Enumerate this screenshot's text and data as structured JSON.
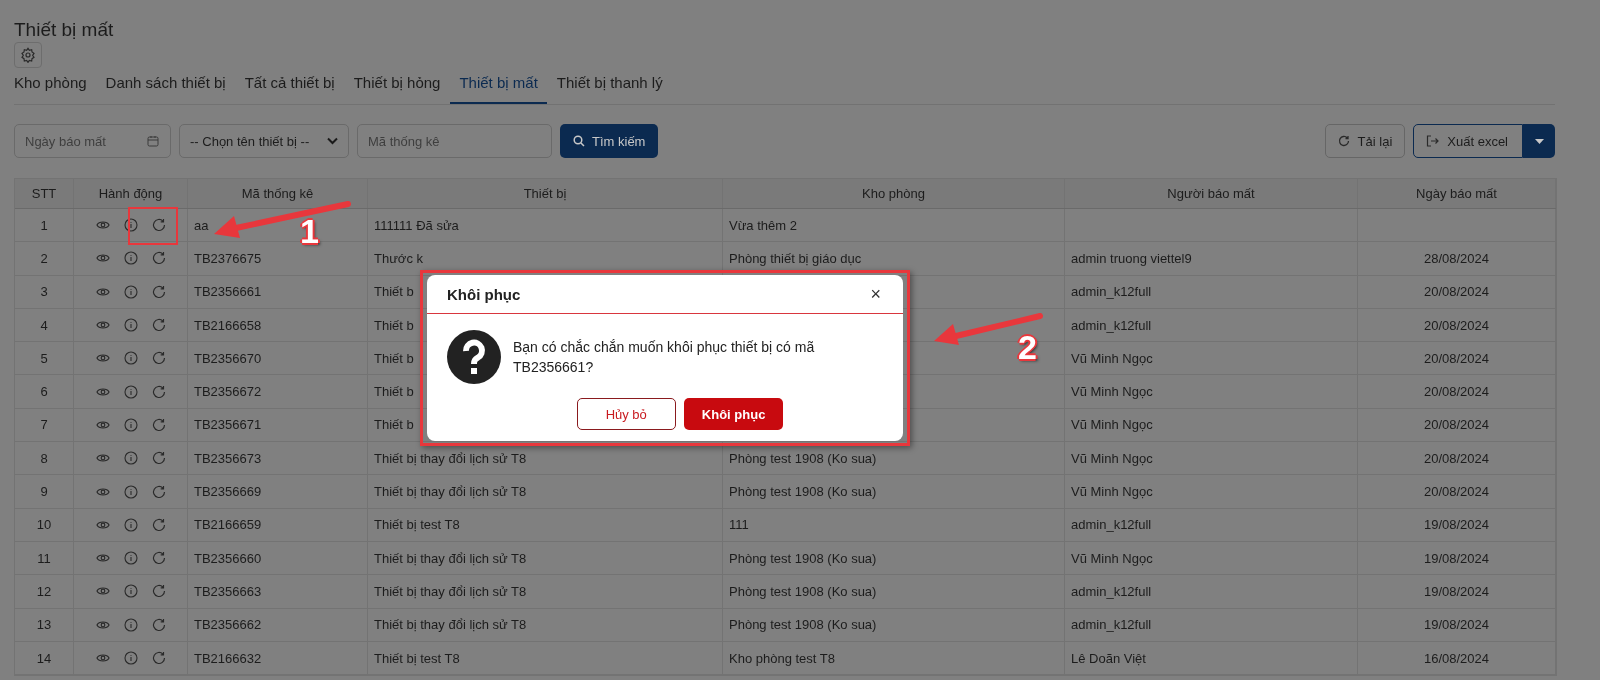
{
  "page": {
    "title": "Thiết bị mất"
  },
  "tabs": [
    {
      "label": "Kho phòng",
      "selected": false
    },
    {
      "label": "Danh sách thiết bị",
      "selected": false
    },
    {
      "label": "Tất cả thiết bị",
      "selected": false
    },
    {
      "label": "Thiết bị hỏng",
      "selected": false
    },
    {
      "label": "Thiết bị mất",
      "selected": true
    },
    {
      "label": "Thiết bị thanh lý",
      "selected": false
    }
  ],
  "filters": {
    "date": {
      "placeholder": "Ngày báo mất"
    },
    "device_select": {
      "value": "-- Chọn tên thiết bị --"
    },
    "code": {
      "placeholder": "Mã thống kê"
    },
    "search_button": "Tìm kiếm"
  },
  "toolbar": {
    "reload_button": "Tải lại",
    "export_button": "Xuất excel"
  },
  "table": {
    "columns": [
      "STT",
      "Hành động",
      "Mã thống kê",
      "Thiết bị",
      "Kho phòng",
      "Người báo mất",
      "Ngày báo mất"
    ],
    "rows": [
      {
        "stt": "1",
        "code": "aa",
        "device": "111111 Đã sửa",
        "room": "Vừa thêm 2"
      },
      {
        "stt": "2",
        "code": "TB2376675",
        "device": "Thước k",
        "room": "Phòng thiết bị giáo dục",
        "reporter": "admin truong viettel9",
        "date": "28/08/2024"
      },
      {
        "stt": "3",
        "code": "TB2356661",
        "device": "Thiết b",
        "reporter": "admin_k12full",
        "date": "20/08/2024"
      },
      {
        "stt": "4",
        "code": "TB2166658",
        "device": "Thiết b",
        "reporter": "admin_k12full",
        "date": "20/08/2024"
      },
      {
        "stt": "5",
        "code": "TB2356670",
        "device": "Thiết b",
        "reporter": "Vũ Minh Ngọc",
        "date": "20/08/2024"
      },
      {
        "stt": "6",
        "code": "TB2356672",
        "device": "Thiết b",
        "reporter": "Vũ Minh Ngọc",
        "date": "20/08/2024"
      },
      {
        "stt": "7",
        "code": "TB2356671",
        "device": "Thiết b",
        "reporter": "Vũ Minh Ngọc",
        "date": "20/08/2024"
      },
      {
        "stt": "8",
        "code": "TB2356673",
        "device": "Thiết bị thay đổi lịch sử T8",
        "room": "Phòng test 1908 (Ko sua)",
        "reporter": "Vũ Minh Ngọc",
        "date": "20/08/2024"
      },
      {
        "stt": "9",
        "code": "TB2356669",
        "device": "Thiết bị thay đổi lịch sử T8",
        "room": "Phòng test 1908 (Ko sua)",
        "reporter": "Vũ Minh Ngọc",
        "date": "20/08/2024"
      },
      {
        "stt": "10",
        "code": "TB2166659",
        "device": "Thiết bị test T8",
        "room": "111",
        "reporter": "admin_k12full",
        "date": "19/08/2024"
      },
      {
        "stt": "11",
        "code": "TB2356660",
        "device": "Thiết bị thay đổi lịch sử T8",
        "room": "Phòng test 1908 (Ko sua)",
        "reporter": "Vũ Minh Ngọc",
        "date": "19/08/2024"
      },
      {
        "stt": "12",
        "code": "TB2356663",
        "device": "Thiết bị thay đổi lịch sử T8",
        "room": "Phòng test 1908 (Ko sua)",
        "reporter": "admin_k12full",
        "date": "19/08/2024"
      },
      {
        "stt": "13",
        "code": "TB2356662",
        "device": "Thiết bị thay đổi lịch sử T8",
        "room": "Phòng test 1908 (Ko sua)",
        "reporter": "admin_k12full",
        "date": "19/08/2024"
      },
      {
        "stt": "14",
        "code": "TB2166632",
        "device": "Thiết bị test T8",
        "room": "Kho phòng test T8",
        "reporter": "Lê Doãn Việt",
        "date": "16/08/2024"
      }
    ]
  },
  "dialog": {
    "title": "Khôi phục",
    "close": "×",
    "message": "Bạn có chắc chắn muốn khôi phục thiết bị có mã TB2356661?",
    "buttons": [
      {
        "label": "Hủy bỏ",
        "kind": "cancel"
      },
      {
        "label": "Khôi phục",
        "kind": "confirm"
      }
    ]
  },
  "annotations": [
    {
      "label": "1"
    },
    {
      "label": "2"
    }
  ]
}
